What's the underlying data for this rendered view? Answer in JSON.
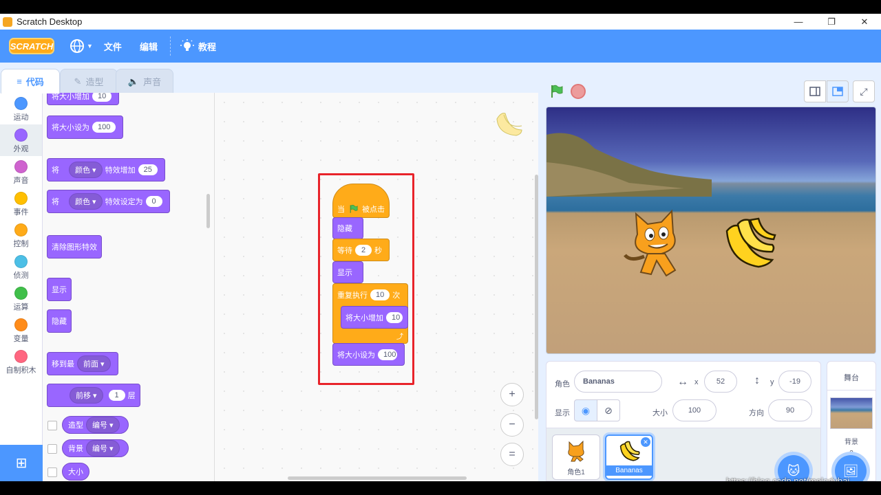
{
  "window": {
    "title": "Scratch Desktop",
    "minimize": "—",
    "restore": "❐",
    "close": "✕"
  },
  "menu": {
    "logo": "SCRATCH",
    "language_icon": "globe-icon",
    "file": "文件",
    "edit": "编辑",
    "tutorials": "教程"
  },
  "tabs": [
    {
      "label": "代码"
    },
    {
      "label": "造型"
    },
    {
      "label": "声音"
    }
  ],
  "categories": [
    {
      "label": "运动",
      "color": "#4c97ff"
    },
    {
      "label": "外观",
      "color": "#9966ff"
    },
    {
      "label": "声音",
      "color": "#cf63cf"
    },
    {
      "label": "事件",
      "color": "#ffbf00"
    },
    {
      "label": "控制",
      "color": "#ffab19"
    },
    {
      "label": "侦测",
      "color": "#4cbfe6"
    },
    {
      "label": "运算",
      "color": "#40bf4a"
    },
    {
      "label": "变量",
      "color": "#ff8c1a"
    },
    {
      "label": "自制积木",
      "color": "#ff6680"
    }
  ],
  "palette": {
    "change_size": {
      "text": "将大小增加",
      "value": "10"
    },
    "set_size": {
      "text": "将大小设为",
      "value": "100"
    },
    "change_effect": {
      "prefix": "将",
      "dropdown": "颜色",
      "text": "特效增加",
      "value": "25"
    },
    "set_effect": {
      "prefix": "将",
      "dropdown": "颜色",
      "text": "特效设定为",
      "value": "0"
    },
    "clear_effects": "清除图形特效",
    "show": "显示",
    "hide": "隐藏",
    "go_to_layer": {
      "text": "移到最",
      "dropdown": "前面"
    },
    "go_layers": {
      "dropdown": "前移",
      "value": "1",
      "suffix": "层"
    },
    "costume": {
      "text": "造型",
      "dropdown": "编号"
    },
    "backdrop": {
      "text": "背景",
      "dropdown": "编号"
    },
    "size": "大小"
  },
  "script": {
    "hat": {
      "prefix": "当",
      "suffix": "被点击"
    },
    "hide": "隐藏",
    "wait": {
      "text": "等待",
      "value": "2",
      "suffix": "秒"
    },
    "show": "显示",
    "repeat": {
      "text": "重复执行",
      "value": "10",
      "suffix": "次"
    },
    "change_size": {
      "text": "将大小增加",
      "value": "10"
    },
    "set_size": {
      "text": "将大小设为",
      "value": "100"
    }
  },
  "zoom": {
    "in": "+",
    "out": "−",
    "reset": "="
  },
  "sprite_info": {
    "sprite_label": "角色",
    "sprite_name": "Bananas",
    "x_label": "x",
    "x_value": "52",
    "y_label": "y",
    "y_value": "-19",
    "show_label": "显示",
    "size_label": "大小",
    "size_value": "100",
    "direction_label": "方向",
    "direction_value": "90"
  },
  "sprites": [
    {
      "name": "角色1"
    },
    {
      "name": "Bananas"
    }
  ],
  "stage_panel": {
    "title": "舞台",
    "backdrop_label": "背景",
    "backdrop_count": "3"
  },
  "watermark": "https://blog.csdn.net/melodybai"
}
